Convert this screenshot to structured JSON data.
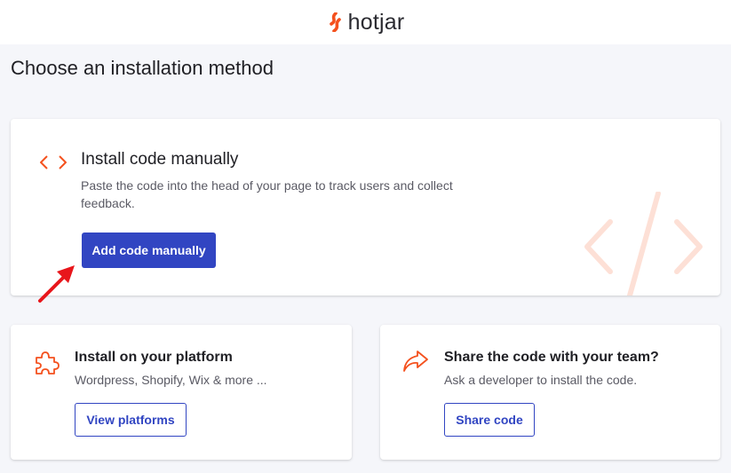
{
  "header": {
    "logo_text": "hotjar",
    "logo_icon": "hotjar-flame-icon"
  },
  "page_title": "Choose an installation method",
  "main_card": {
    "icon": "code-brackets-icon",
    "title": "Install code manually",
    "description": "Paste the code into the head of your page to track users and collect feedback.",
    "button_label": "Add code manually",
    "watermark_icon": "code-slash-watermark-icon"
  },
  "platform_card": {
    "icon": "puzzle-icon",
    "title": "Install on your platform",
    "description": "Wordpress, Shopify, Wix & more ...",
    "button_label": "View platforms"
  },
  "share_card": {
    "icon": "share-arrow-icon",
    "title": "Share the code with your team?",
    "description": "Ask a developer to install the code.",
    "button_label": "Share code"
  },
  "annotation": {
    "icon": "red-arrow-icon"
  },
  "colors": {
    "accent": "#3145c2",
    "orange": "#f4511e",
    "background": "#f5f6fa",
    "annotation_red": "#e8161b"
  }
}
